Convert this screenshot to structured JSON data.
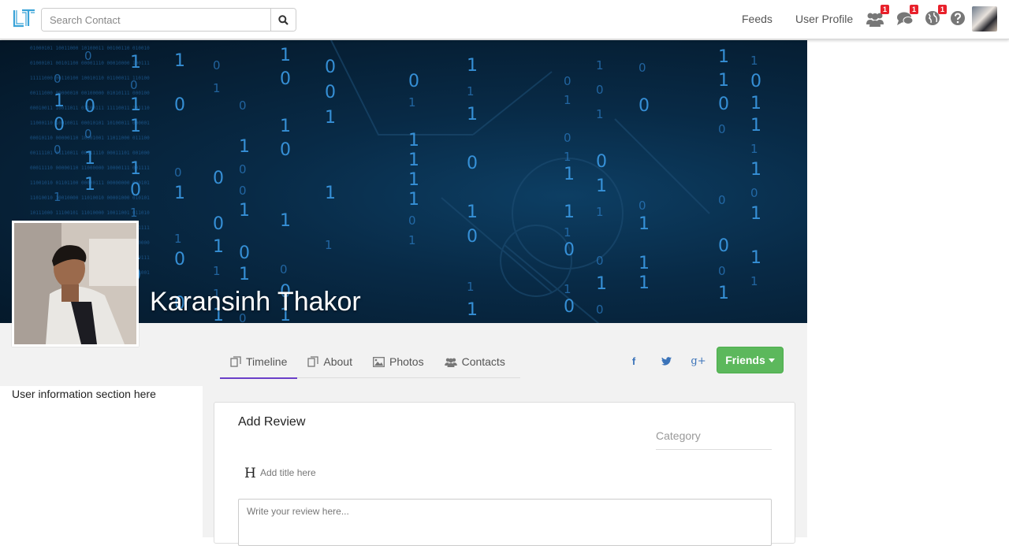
{
  "navbar": {
    "logo_text": "LT",
    "search": {
      "placeholder": "Search Contact",
      "value": ""
    },
    "links": {
      "feeds": "Feeds",
      "user_profile": "User Profile"
    },
    "notifications": {
      "friends": "1",
      "messages": "1",
      "global": "1"
    },
    "icons": [
      "search-icon",
      "users-icon",
      "comments-icon",
      "globe-icon",
      "question-icon"
    ]
  },
  "profile": {
    "name": "Karansinh Thakor",
    "tabs": [
      {
        "label": "Timeline",
        "icon": "timeline-icon"
      },
      {
        "label": "About",
        "icon": "about-icon"
      },
      {
        "label": "Photos",
        "icon": "photo-icon"
      },
      {
        "label": "Contacts",
        "icon": "users-icon"
      }
    ],
    "active_tab": "Timeline",
    "social": {
      "facebook": "f",
      "google": "g+"
    },
    "friends_button": "Friends"
  },
  "sidebar": {
    "info_text": "User information section here"
  },
  "review": {
    "heading": "Add Review",
    "category_label": "Category",
    "title_icon": "H",
    "title_placeholder": "Add title here",
    "body_placeholder": "Write your review here..."
  },
  "colors": {
    "accent_tab": "#6a3fc8",
    "friends_btn": "#5cb85c",
    "badge": "#e8202b",
    "link_blue": "#3b73b9"
  }
}
